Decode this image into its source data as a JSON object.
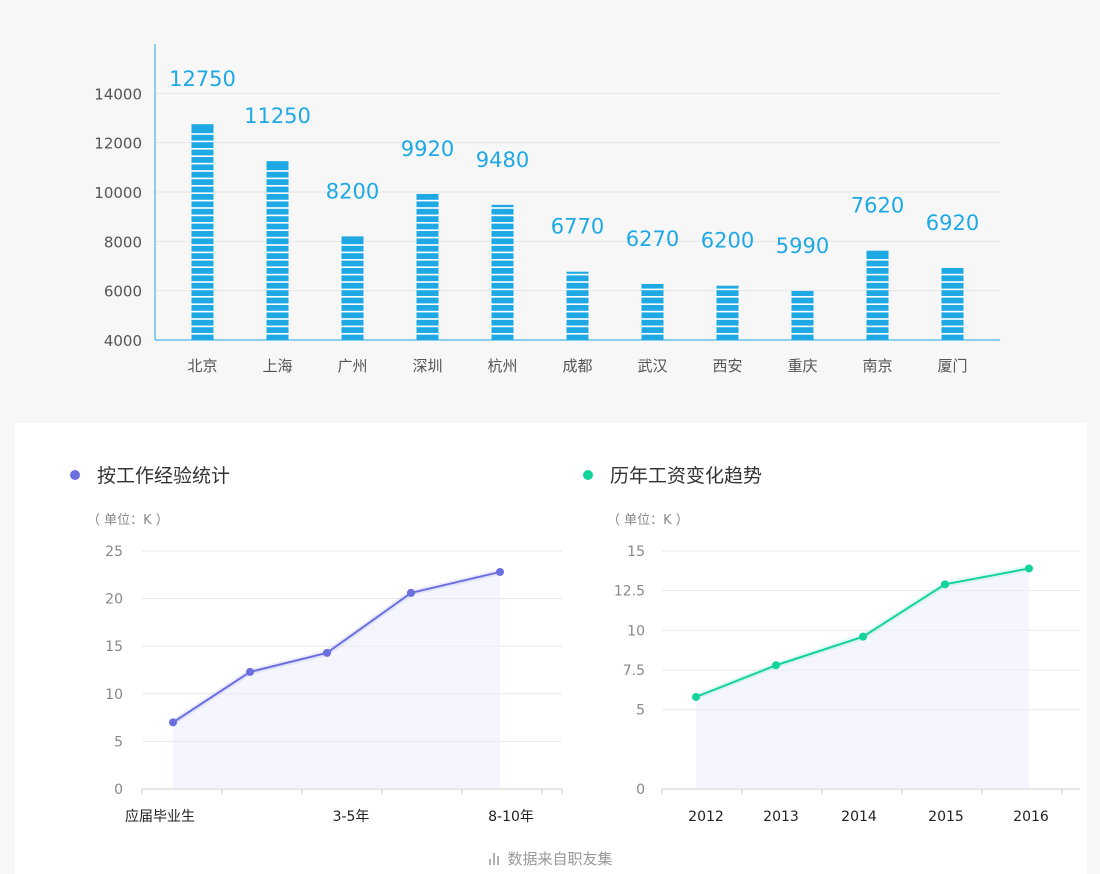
{
  "colors": {
    "bar": "#1ea9e5",
    "exp_line": "#6b6fe0",
    "salary_line": "#12d39c",
    "fill": "#ededfc"
  },
  "chart_data": [
    {
      "type": "bar",
      "categories": [
        "北京",
        "上海",
        "广州",
        "深圳",
        "杭州",
        "成都",
        "武汉",
        "西安",
        "重庆",
        "南京",
        "厦门"
      ],
      "values": [
        12750,
        11250,
        8200,
        9920,
        9480,
        6770,
        6270,
        6200,
        5990,
        7620,
        6920
      ],
      "data_labels": [
        "12750",
        "11250",
        "8200",
        "9920",
        "9480",
        "6770",
        "6270",
        "6200",
        "5990",
        "7620",
        "6920"
      ],
      "ylim": [
        4000,
        16000
      ],
      "yticks": [
        "4000",
        "6000",
        "8000",
        "10000",
        "12000",
        "14000"
      ],
      "grid": true
    },
    {
      "type": "line",
      "title": "按工作经验统计",
      "unit": "（ 单位：K ）",
      "x": [
        "应届毕业生",
        "",
        "3-5年",
        "",
        "8-10年"
      ],
      "values": [
        7,
        12.3,
        14.3,
        20.6,
        22.8
      ],
      "ylim": [
        0,
        25
      ],
      "yticks": [
        "0",
        "5",
        "10",
        "15",
        "20",
        "25"
      ],
      "grid": true
    },
    {
      "type": "line",
      "title": "历年工资变化趋势",
      "unit": "（ 单位：K ）",
      "x": [
        "2012",
        "2013",
        "2014",
        "2015",
        "2016"
      ],
      "values": [
        5.8,
        7.8,
        9.6,
        12.9,
        13.9
      ],
      "ylim": [
        0,
        15
      ],
      "yticks": [
        "0",
        "5",
        "7.5",
        "10",
        "12.5",
        "15"
      ],
      "grid": true
    }
  ],
  "footer": {
    "text": "数据来自职友集"
  }
}
